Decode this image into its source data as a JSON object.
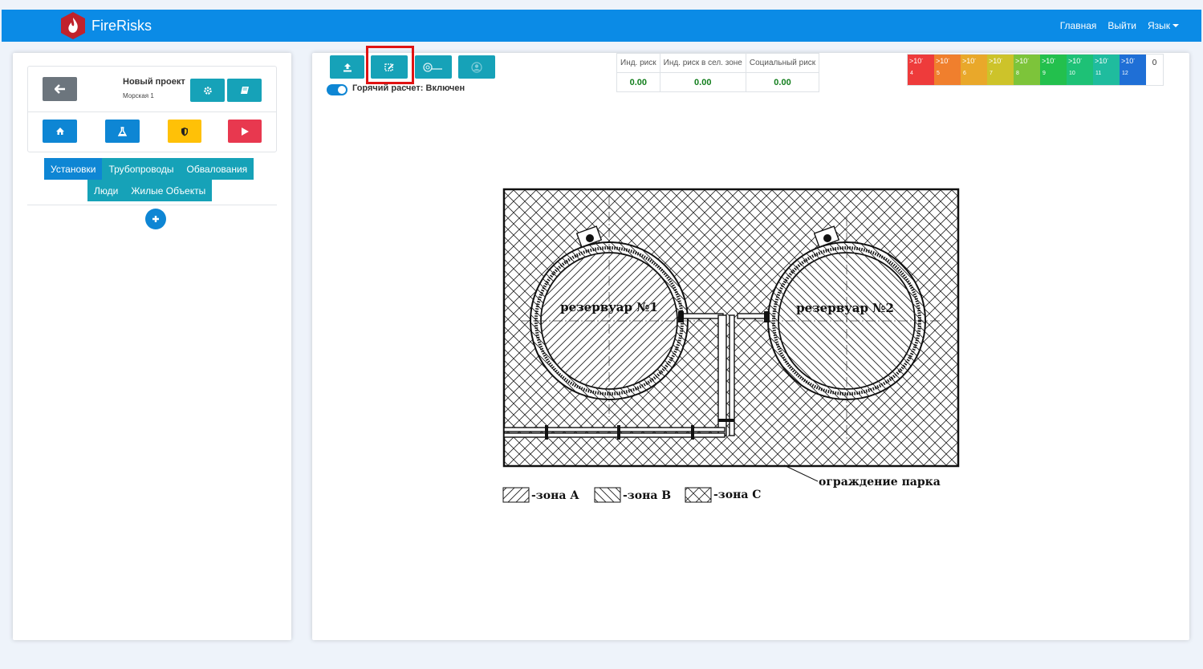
{
  "navbar": {
    "brand": "FireRisks",
    "links": {
      "home": "Главная",
      "logout": "Выйти",
      "language": "Язык"
    }
  },
  "project": {
    "name": "Новый проект",
    "subtitle": "Морская 1"
  },
  "tabs": {
    "row1": [
      "Установки",
      "Трубопроводы",
      "Обвалования"
    ],
    "row2": [
      "Люди",
      "Жилые Объекты"
    ]
  },
  "toolbar": {
    "hot_calc_label": "Горячий расчет: Включен"
  },
  "risk_table": {
    "headers": [
      "Инд. риск",
      "Инд. риск в сел. зоне",
      "Социальный риск"
    ],
    "values": [
      "0.00",
      "0.00",
      "0.00"
    ]
  },
  "legend_scale": {
    "cells": [
      {
        "label": ">10",
        "exp": "4",
        "color": "#ee3b3b"
      },
      {
        "label": ">10",
        "exp": "5",
        "color": "#f07f2d"
      },
      {
        "label": ">10",
        "exp": "6",
        "color": "#e9a82a"
      },
      {
        "label": ">10",
        "exp": "7",
        "color": "#cdc32a"
      },
      {
        "label": ">10",
        "exp": "8",
        "color": "#7dc43a"
      },
      {
        "label": ">10",
        "exp": "9",
        "color": "#23c04d"
      },
      {
        "label": ">10",
        "exp": "10",
        "color": "#1ec176"
      },
      {
        "label": ">10",
        "exp": "11",
        "color": "#1fbc9e"
      },
      {
        "label": ">10",
        "exp": "12",
        "color": "#1f6fd6"
      }
    ],
    "zero": "0"
  },
  "drawing": {
    "tank1": "резервуар №1",
    "tank2": "резервуар №2",
    "fence_label": "ограждение парка",
    "zones": [
      "-зона А",
      "-зона В",
      "-зона С"
    ]
  },
  "colors": {
    "navbar": "#0b8be6",
    "teal": "#16a2b8",
    "primary": "#0e86d4",
    "highlight": "#e01313",
    "green_value": "#127e1c"
  }
}
